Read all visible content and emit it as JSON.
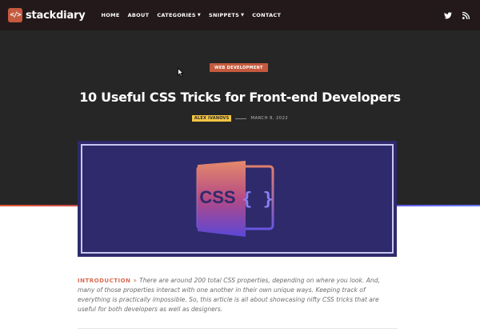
{
  "site": {
    "logo_mark": "</>",
    "logo_text": "stackdiary"
  },
  "nav": {
    "items": [
      {
        "label": "HOME",
        "has_dropdown": false
      },
      {
        "label": "ABOUT",
        "has_dropdown": false
      },
      {
        "label": "CATEGORIES",
        "has_dropdown": true
      },
      {
        "label": "SNIPPETS",
        "has_dropdown": true
      },
      {
        "label": "CONTACT",
        "has_dropdown": false
      }
    ],
    "icons": [
      "twitter-icon",
      "rss-icon"
    ]
  },
  "article": {
    "category": "WEB DEVELOPMENT",
    "title": "10 Useful CSS Tricks for Front-end Developers",
    "author": "ALEX IVANOVS",
    "date": "MARCH 8, 2022",
    "feature_image": {
      "text": "CSS",
      "brace_text": "{ }"
    },
    "intro_label": "INTRODUCTION",
    "intro_arrow": "»",
    "intro_text": "There are around 200 total CSS properties, depending on where you look. And, many of those properties interact with one another in their own unique ways. Keeping track of everything is practically impossible. So, this article is all about showcasing nifty CSS tricks that are useful for both developers as well as designers."
  },
  "colors": {
    "nav_bg": "#23191a",
    "hero_bg": "#262626",
    "accent": "#c55a3e",
    "author_badge": "#f4c542",
    "feature_bg": "#2e2a6b"
  }
}
